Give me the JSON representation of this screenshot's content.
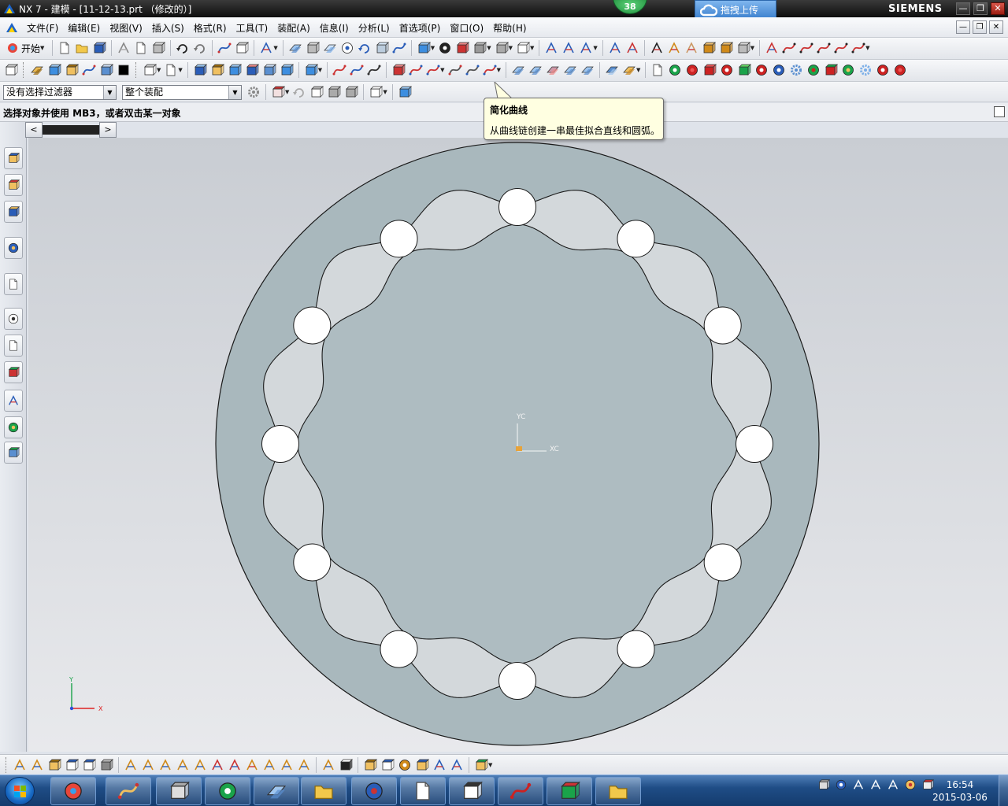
{
  "window": {
    "title": "NX 7 - 建模 - [11-12-13.prt （修改的）]",
    "notification_count": "38",
    "upload_label": "拖拽上传",
    "brand": "SIEMENS",
    "controls": [
      "—",
      "❐",
      "✕"
    ]
  },
  "menubar": {
    "items": [
      "文件(F)",
      "编辑(E)",
      "视图(V)",
      "插入(S)",
      "格式(R)",
      "工具(T)",
      "装配(A)",
      "信息(I)",
      "分析(L)",
      "首选项(P)",
      "窗口(O)",
      "帮助(H)"
    ],
    "mdi_controls": [
      "—",
      "❐",
      "✕"
    ]
  },
  "toolbar1": {
    "start_label": "开始",
    "overflow": "»"
  },
  "selection_bar": {
    "type_filter": "没有选择过滤器",
    "scope": "整个装配"
  },
  "cue_line": {
    "text": "选择对象并使用 MB3，或者双击某一对象"
  },
  "tooltip": {
    "title": "简化曲线",
    "body": "从曲线链创建一串最佳拟合直线和圆弧。"
  },
  "scroll": {
    "left": "<",
    "right": ">"
  },
  "graphics": {
    "wcs_labels": {
      "yc": "YC",
      "xc": "XC"
    },
    "abs_axes": {
      "y": "Y",
      "x": "X"
    },
    "hole_count": 12,
    "colors": {
      "background_top": "#c9cdd3",
      "background_bottom": "#e8e9ec",
      "outer_ring": "#a9b8bd",
      "inner_body": "#aebcc1",
      "groove": "#d3d8db",
      "hole": "#ffffff",
      "outline": "#1a1a1a"
    }
  },
  "taskbar": {
    "time": "16:54",
    "date": "2015-03-06"
  }
}
